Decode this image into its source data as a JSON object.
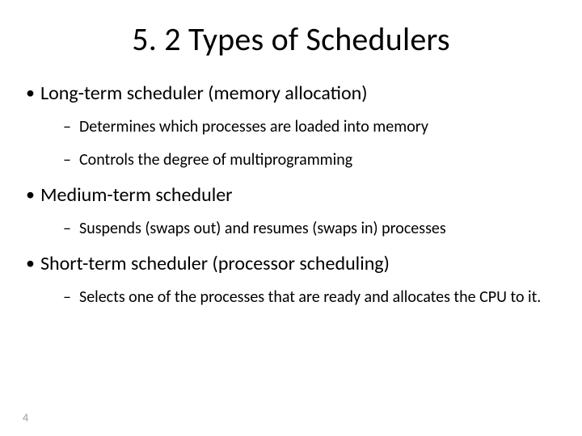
{
  "title": "5. 2 Types of Schedulers",
  "bullets": [
    {
      "text": "Long-term scheduler (memory allocation)",
      "sub": [
        "Determines which processes are loaded into memory",
        "Controls the degree of multiprogramming"
      ]
    },
    {
      "text": "Medium-term scheduler",
      "sub": [
        "Suspends (swaps out) and resumes (swaps in) processes"
      ]
    },
    {
      "text": "Short-term scheduler (processor scheduling)",
      "sub": [
        "Selects one of the processes that are ready and allocates the CPU to it."
      ]
    }
  ],
  "pageNumber": "4"
}
